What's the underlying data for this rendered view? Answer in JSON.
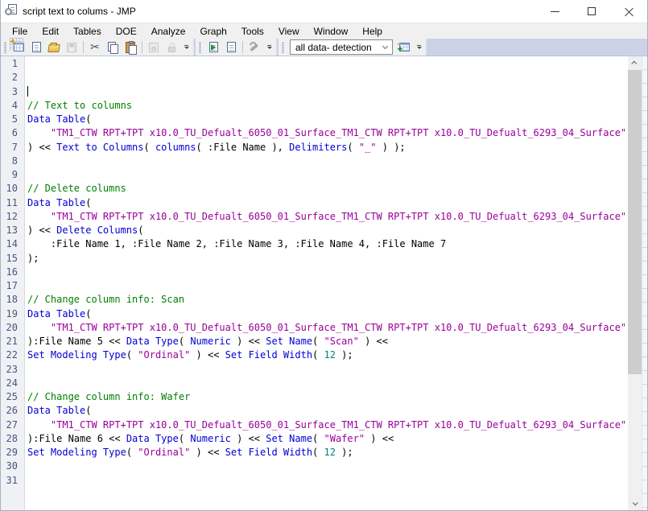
{
  "window": {
    "title": "script text to colums - JMP"
  },
  "menu": {
    "items": [
      "File",
      "Edit",
      "Tables",
      "DOE",
      "Analyze",
      "Graph",
      "Tools",
      "View",
      "Window",
      "Help"
    ]
  },
  "toolbar": {
    "combo": {
      "value": "all data- detection"
    },
    "groups": [
      {
        "items": [
          {
            "type": "icon",
            "name": "new-data-table",
            "enabled": true
          },
          {
            "type": "icon",
            "name": "new-script",
            "enabled": true
          },
          {
            "type": "icon",
            "name": "open-folder",
            "enabled": true
          },
          {
            "type": "icon",
            "name": "save",
            "enabled": false
          },
          {
            "type": "sep"
          },
          {
            "type": "icon",
            "name": "cut",
            "enabled": true
          },
          {
            "type": "icon",
            "name": "copy",
            "enabled": true
          },
          {
            "type": "icon",
            "name": "paste",
            "enabled": true
          },
          {
            "type": "sep"
          },
          {
            "type": "icon",
            "name": "properties",
            "enabled": false
          },
          {
            "type": "icon",
            "name": "lock",
            "enabled": false
          },
          {
            "type": "overflow"
          }
        ]
      },
      {
        "items": [
          {
            "type": "icon",
            "name": "run-script",
            "enabled": true
          },
          {
            "type": "icon",
            "name": "script-window",
            "enabled": true
          },
          {
            "type": "sep"
          },
          {
            "type": "icon",
            "name": "run-tools",
            "enabled": true
          },
          {
            "type": "overflow"
          }
        ]
      },
      {
        "items": [
          {
            "type": "combo",
            "name": "data-filter-combo"
          },
          {
            "type": "icon",
            "name": "add-to-data-table",
            "enabled": true
          },
          {
            "type": "overflow"
          }
        ]
      }
    ]
  },
  "editor": {
    "caret_line": 3,
    "syntax_colors": {
      "plain": "#000000",
      "comment": "#007f00",
      "keyword": "#0000d4",
      "string": "#990099",
      "number": "#007f7f"
    },
    "lines": [
      [],
      [],
      [],
      [
        [
          "comment",
          "// Text to columns"
        ]
      ],
      [
        [
          "keyword",
          "Data Table"
        ],
        [
          "plain",
          "("
        ]
      ],
      [
        [
          "plain",
          "    "
        ],
        [
          "string",
          "\"TM1_CTW RPT+TPT x10.0_TU_Defualt_6050_01_Surface_TM1_CTW RPT+TPT x10.0_TU_Defualt_6293_04_Surface\""
        ]
      ],
      [
        [
          "plain",
          ") << "
        ],
        [
          "keyword",
          "Text to Columns"
        ],
        [
          "plain",
          "( "
        ],
        [
          "keyword",
          "columns"
        ],
        [
          "plain",
          "( :File Name ), "
        ],
        [
          "keyword",
          "Delimiters"
        ],
        [
          "plain",
          "( "
        ],
        [
          "string",
          "\"_\""
        ],
        [
          "plain",
          " ) );"
        ]
      ],
      [],
      [],
      [
        [
          "comment",
          "// Delete columns"
        ]
      ],
      [
        [
          "keyword",
          "Data Table"
        ],
        [
          "plain",
          "("
        ]
      ],
      [
        [
          "plain",
          "    "
        ],
        [
          "string",
          "\"TM1_CTW RPT+TPT x10.0_TU_Defualt_6050_01_Surface_TM1_CTW RPT+TPT x10.0_TU_Defualt_6293_04_Surface\""
        ]
      ],
      [
        [
          "plain",
          ") << "
        ],
        [
          "keyword",
          "Delete Columns"
        ],
        [
          "plain",
          "("
        ]
      ],
      [
        [
          "plain",
          "    :File Name 1, :File Name 2, :File Name 3, :File Name 4, :File Name 7"
        ]
      ],
      [
        [
          "plain",
          ");"
        ]
      ],
      [],
      [],
      [
        [
          "comment",
          "// Change column info: Scan"
        ]
      ],
      [
        [
          "keyword",
          "Data Table"
        ],
        [
          "plain",
          "("
        ]
      ],
      [
        [
          "plain",
          "    "
        ],
        [
          "string",
          "\"TM1_CTW RPT+TPT x10.0_TU_Defualt_6050_01_Surface_TM1_CTW RPT+TPT x10.0_TU_Defualt_6293_04_Surface\""
        ]
      ],
      [
        [
          "plain",
          "):File Name 5 << "
        ],
        [
          "keyword",
          "Data Type"
        ],
        [
          "plain",
          "( "
        ],
        [
          "keyword",
          "Numeric"
        ],
        [
          "plain",
          " ) << "
        ],
        [
          "keyword",
          "Set Name"
        ],
        [
          "plain",
          "( "
        ],
        [
          "string",
          "\"Scan\""
        ],
        [
          "plain",
          " ) <<"
        ]
      ],
      [
        [
          "keyword",
          "Set Modeling Type"
        ],
        [
          "plain",
          "( "
        ],
        [
          "string",
          "\"Ordinal\""
        ],
        [
          "plain",
          " ) << "
        ],
        [
          "keyword",
          "Set Field Width"
        ],
        [
          "plain",
          "( "
        ],
        [
          "number",
          "12"
        ],
        [
          "plain",
          " );"
        ]
      ],
      [],
      [],
      [
        [
          "comment",
          "// Change column info: Wafer"
        ]
      ],
      [
        [
          "keyword",
          "Data Table"
        ],
        [
          "plain",
          "("
        ]
      ],
      [
        [
          "plain",
          "    "
        ],
        [
          "string",
          "\"TM1_CTW RPT+TPT x10.0_TU_Defualt_6050_01_Surface_TM1_CTW RPT+TPT x10.0_TU_Defualt_6293_04_Surface\""
        ]
      ],
      [
        [
          "plain",
          "):File Name 6 << "
        ],
        [
          "keyword",
          "Data Type"
        ],
        [
          "plain",
          "( "
        ],
        [
          "keyword",
          "Numeric"
        ],
        [
          "plain",
          " ) << "
        ],
        [
          "keyword",
          "Set Name"
        ],
        [
          "plain",
          "( "
        ],
        [
          "string",
          "\"Wafer\""
        ],
        [
          "plain",
          " ) <<"
        ]
      ],
      [
        [
          "keyword",
          "Set Modeling Type"
        ],
        [
          "plain",
          "( "
        ],
        [
          "string",
          "\"Ordinal\""
        ],
        [
          "plain",
          " ) << "
        ],
        [
          "keyword",
          "Set Field Width"
        ],
        [
          "plain",
          "( "
        ],
        [
          "number",
          "12"
        ],
        [
          "plain",
          " );"
        ]
      ],
      [],
      []
    ]
  }
}
